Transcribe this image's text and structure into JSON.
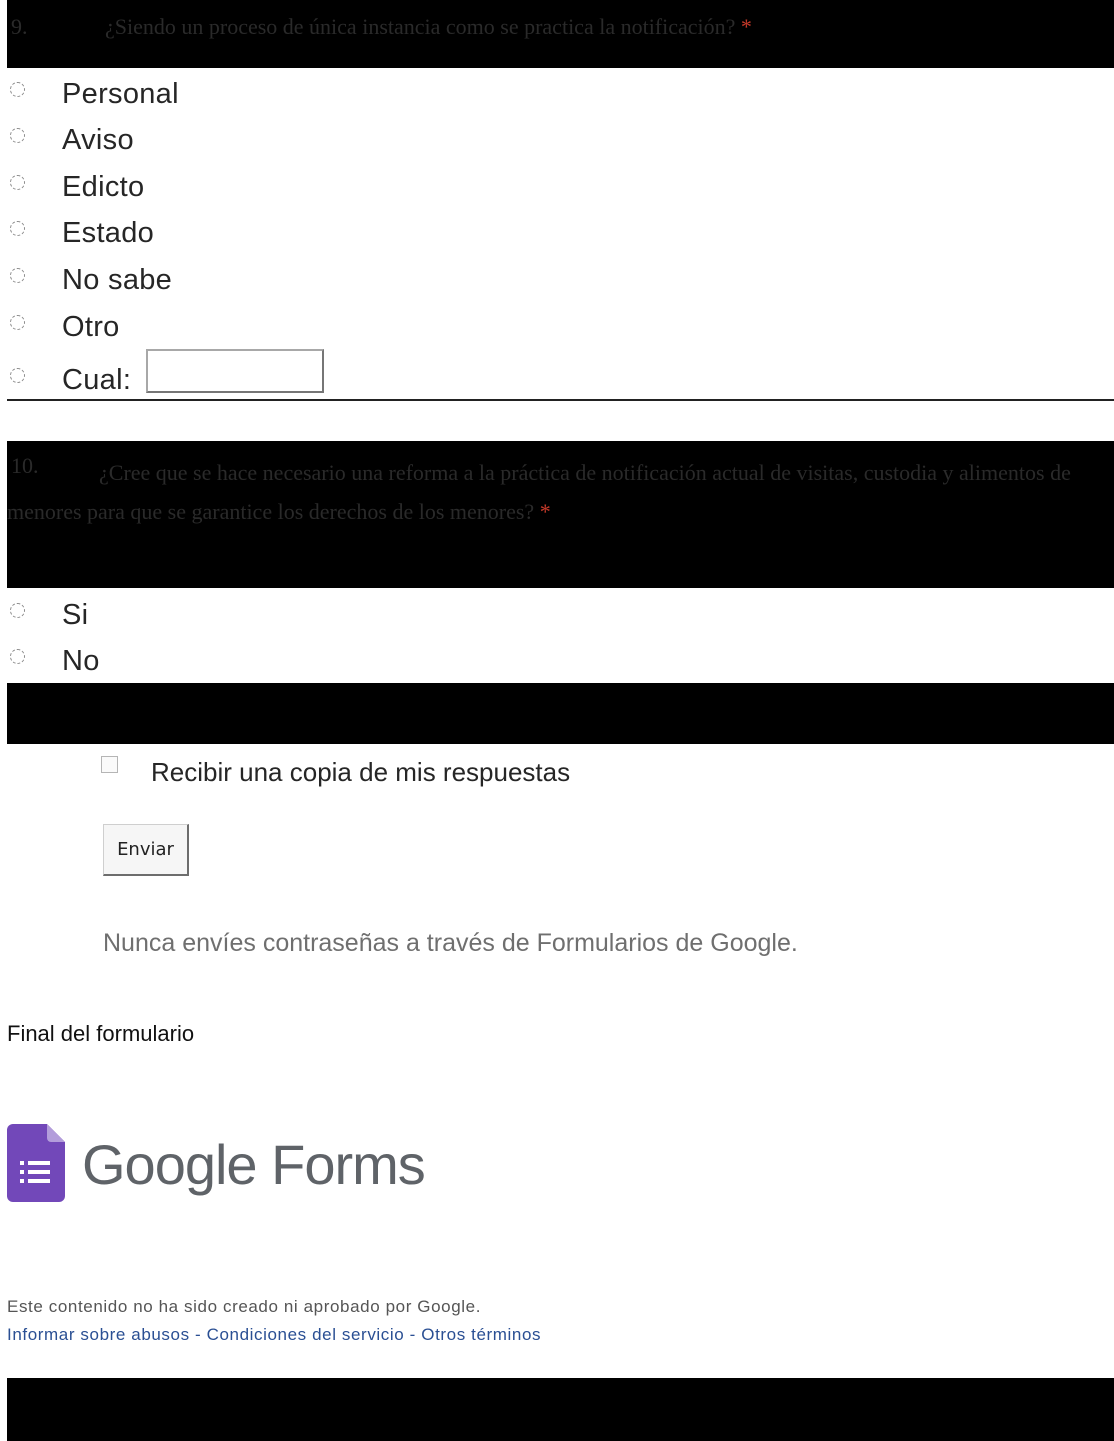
{
  "question9": {
    "number": "9.",
    "text": "¿Siendo un proceso de única instancia como se practica la notificación?",
    "required_mark": "*",
    "options": [
      "Personal",
      "Aviso",
      "Edicto",
      "Estado",
      "No sabe",
      "Otro",
      "Cual:"
    ],
    "other_value": ""
  },
  "question10": {
    "number": "10.",
    "text": "¿Cree que se hace necesario una reforma a la práctica de notificación actual de visitas, custodia y alimentos de menores para que se garantice los derechos de los menores?",
    "required_mark": "*",
    "options": [
      "Si",
      "No"
    ]
  },
  "footer_form": {
    "copy_label": "Recibir una copia de mis respuestas",
    "submit_label": "Enviar",
    "password_warning": "Nunca envíes contraseñas a través de Formularios de Google."
  },
  "end_label": "Final del formulario",
  "brand": {
    "google": "Google",
    "forms": "Forms",
    "color": "#7248b9"
  },
  "legal": {
    "disclaimer": "Este contenido no ha sido creado ni aprobado por Google.",
    "report_abuse": "Informar sobre abusos",
    "separator": " - ",
    "terms": "Condiciones del servicio",
    "other_terms": "Otros términos"
  }
}
